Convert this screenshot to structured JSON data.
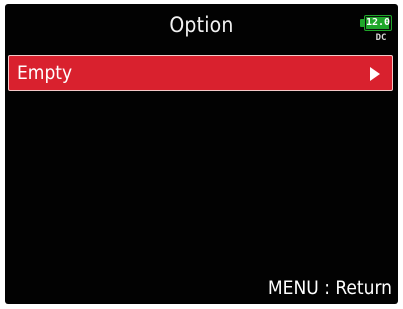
{
  "header": {
    "title": "Option",
    "battery": {
      "voltage": "12.0",
      "source": "DC",
      "level": 1.0,
      "color": "#1fa72a"
    }
  },
  "menu": {
    "items": [
      {
        "label": "Empty",
        "selected": true,
        "icon": "chevron-right-icon"
      }
    ],
    "highlight_color": "#d9212e"
  },
  "footer": {
    "hint": "MENU : Return"
  }
}
